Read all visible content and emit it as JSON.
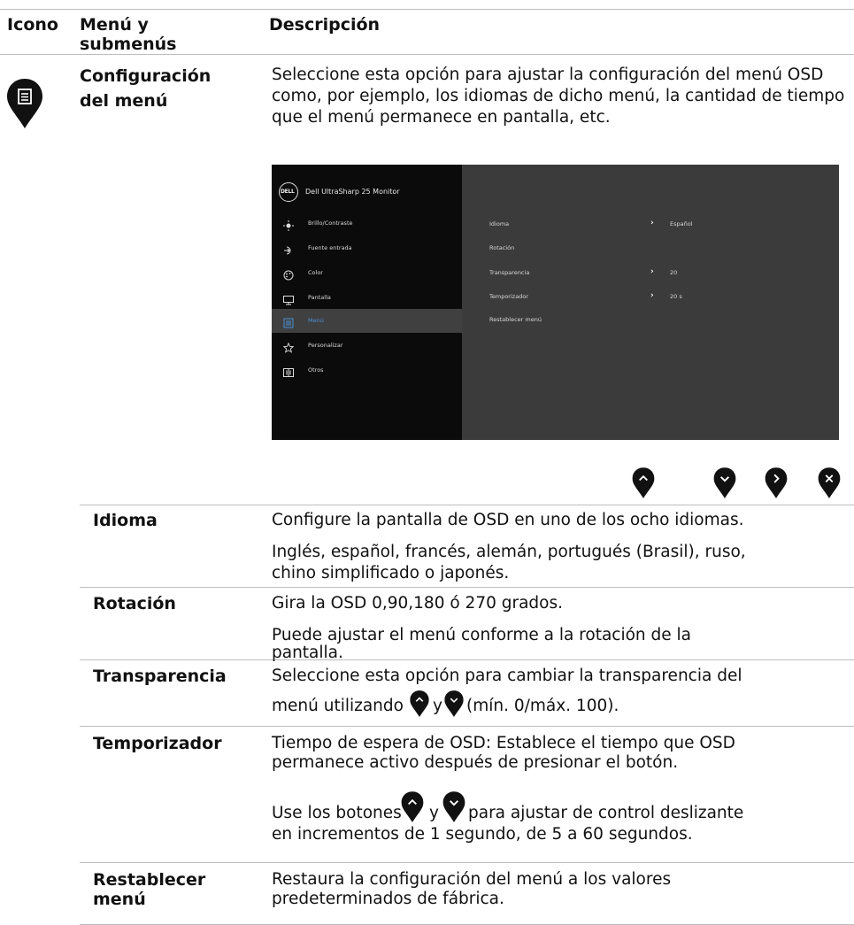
{
  "header": {
    "col1": "Icono",
    "col2_line1": "Menú y",
    "col2_line2": "submenús",
    "col3": "Descripción"
  },
  "section": {
    "title_line1": "Configuración",
    "title_line2": "del menú",
    "description": "Seleccione esta opción para ajustar la configuración del menú OSD como, por ejemplo, los idiomas de dicho menú, la cantidad de tiempo que el menú permanece en pantalla, etc.",
    "section_icon": "menu-list-icon"
  },
  "osd": {
    "brand": "DELL",
    "title": "Dell UltraSharp 25 Monitor",
    "menu": [
      {
        "label": "Brillo/Contraste",
        "icon": "brightness-icon"
      },
      {
        "label": "Fuente entrada",
        "icon": "input-source-icon"
      },
      {
        "label": "Color",
        "icon": "color-palette-icon"
      },
      {
        "label": "Pantalla",
        "icon": "display-icon"
      },
      {
        "label": "Menú",
        "icon": "menu-list-icon"
      },
      {
        "label": "Personalizar",
        "icon": "star-icon"
      },
      {
        "label": "Otros",
        "icon": "others-icon"
      }
    ],
    "submenu": [
      {
        "label": "Idioma",
        "value": "Español"
      },
      {
        "label": "Rotación",
        "value": ""
      },
      {
        "label": "Transparencia",
        "value": "20"
      },
      {
        "label": "Temporizador",
        "value": "20 s"
      },
      {
        "label": "Restablecer menú",
        "value": ""
      }
    ],
    "buttons": [
      "up-arrow-icon",
      "down-arrow-icon",
      "right-arrow-icon",
      "close-icon"
    ]
  },
  "rows": [
    {
      "name": "Idioma",
      "lines": [
        "Configure la pantalla de OSD en uno de los ocho idiomas.",
        "Inglés, español, francés, alemán, portugués (Brasil), ruso,",
        "chino simplificado o japonés."
      ]
    },
    {
      "name": "Rotación",
      "lines": [
        "Gira la OSD 0,90,180 ó 270 grados.",
        "Puede ajustar el menú conforme a la rotación de la",
        "pantalla."
      ]
    },
    {
      "name": "Transparencia",
      "lines": [
        "Seleccione esta opción para cambiar la transparencia del",
        "menú utilizando",
        "y",
        "(mín. 0/máx. 100)."
      ]
    },
    {
      "name": "Temporizador",
      "lines": [
        "Tiempo de espera de OSD: Establece el tiempo que OSD",
        "permanece activo después de presionar el botón.",
        "Use los botones",
        "y",
        "para ajustar de control deslizante",
        "en incrementos de 1 segundo, de 5 a 60 segundos."
      ]
    },
    {
      "name_line1": "Restablecer",
      "name_line2": "menú",
      "lines": [
        "Restaura la configuración del menú a los valores",
        "predeterminados de fábrica."
      ]
    }
  ]
}
